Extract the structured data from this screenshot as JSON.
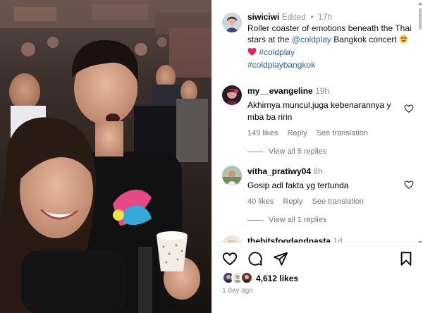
{
  "post": {
    "author": "siwiciwi",
    "edited": "Edited",
    "time": "17h",
    "caption_text": "Roller coaster of emotions beneath the Thai stars at the ",
    "mention": "@coldplay",
    "caption_text_2": " Bangkok concert ",
    "emojis": [
      "smiling-face-with-heart-eyes",
      "red-heart"
    ],
    "hashtag1": "#coldplay",
    "hashtag2": "#coldplaybangkok"
  },
  "comments": [
    {
      "user": "my__evangeline",
      "time": "19h",
      "text": "Akhirnya muncul.juga kebenarannya y mba ba ririn",
      "likes": "149 likes",
      "reply": "Reply",
      "translate": "See translation",
      "view_replies": "View all 5 replies"
    },
    {
      "user": "vitha_pratiwy04",
      "time": "8h",
      "text": "Gosip adl fakta yg tertunda",
      "likes": "40 likes",
      "reply": "Reply",
      "translate": "See translation",
      "view_replies": "View all 1 replies"
    },
    {
      "user": "thebitsfoodandpasta",
      "time": "1d"
    }
  ],
  "actions": {
    "icons": [
      "heart-icon",
      "comment-icon",
      "share-icon",
      "bookmark-icon"
    ]
  },
  "likes": {
    "count_text": "4,612 likes"
  },
  "posted": "1 day ago",
  "colors": {
    "link": "#2f5f96",
    "muted": "#8e8e8e",
    "heart": "#e0245e"
  }
}
